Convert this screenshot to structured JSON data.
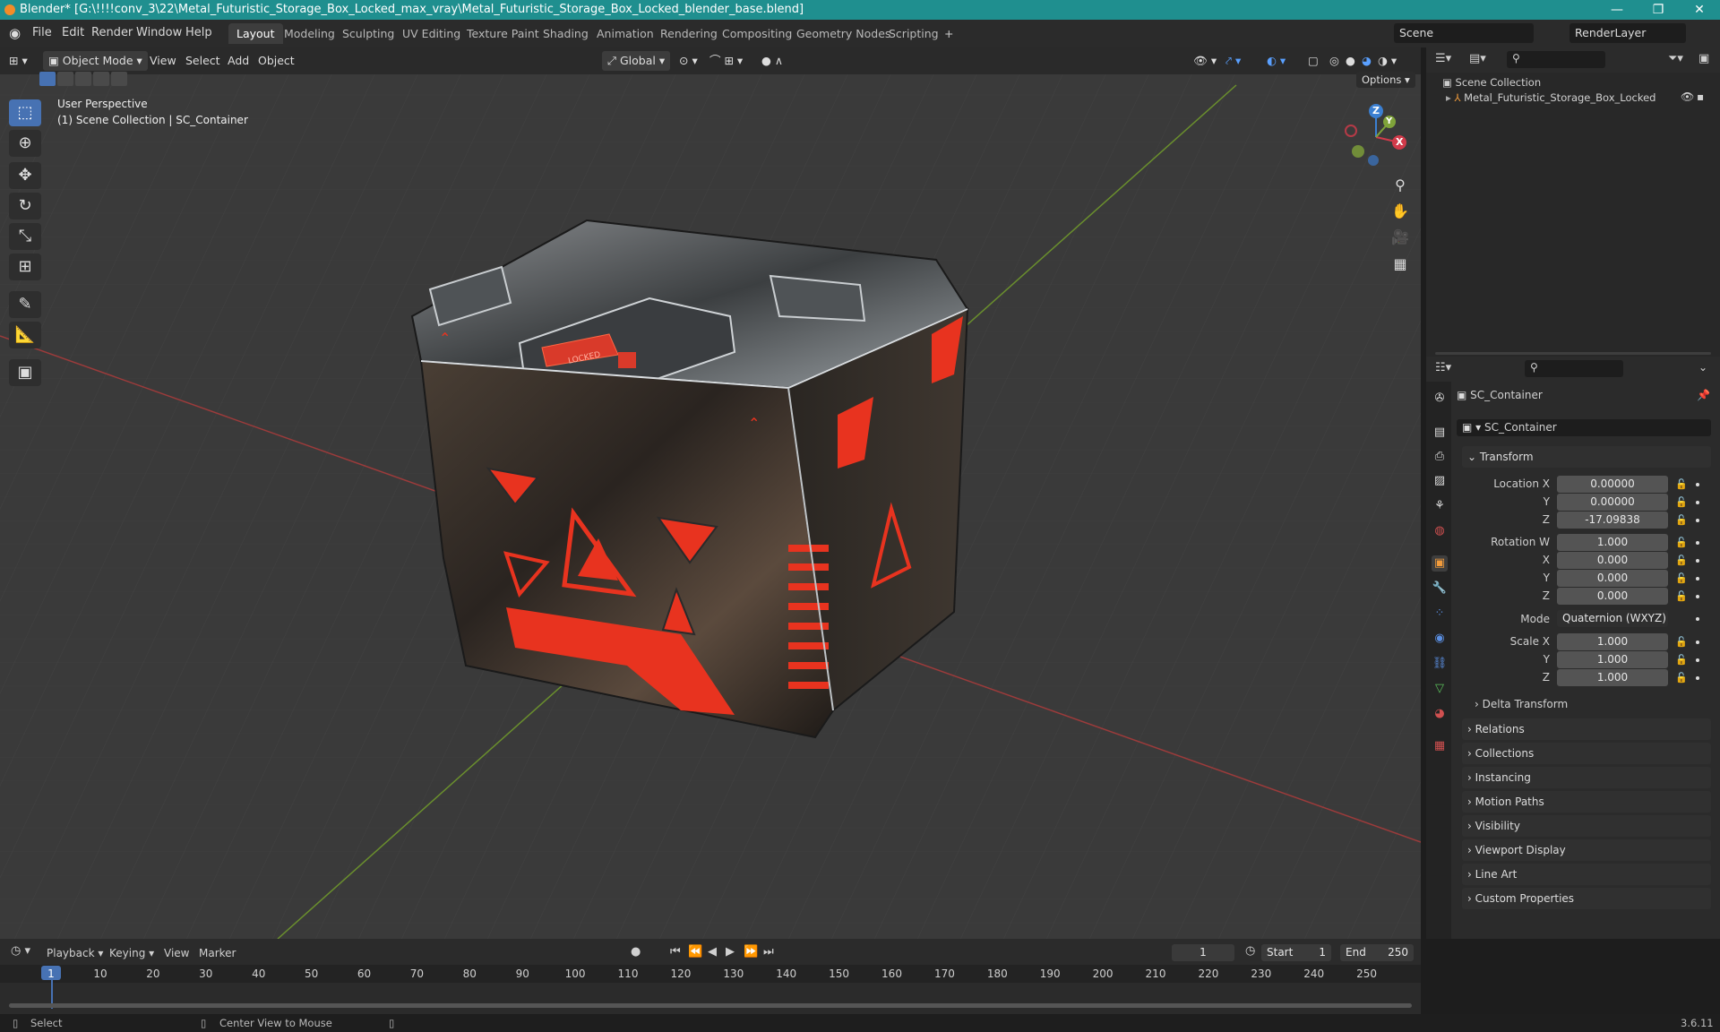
{
  "titlebar": {
    "title": "Blender* [G:\\!!!!conv_3\\22\\Metal_Futuristic_Storage_Box_Locked_max_vray\\Metal_Futuristic_Storage_Box_Locked_blender_base.blend]",
    "minimize": "—",
    "maximize": "❐",
    "close": "✕"
  },
  "menubar": {
    "items": [
      "File",
      "Edit",
      "Render",
      "Window",
      "Help"
    ],
    "workspaces": [
      "Layout",
      "Modeling",
      "Sculpting",
      "UV Editing",
      "Texture Paint",
      "Shading",
      "Animation",
      "Rendering",
      "Compositing",
      "Geometry Nodes",
      "Scripting"
    ],
    "add_workspace": "+",
    "scene": "Scene",
    "render_layer": "RenderLayer"
  },
  "viewport_header": {
    "mode": "Object Mode",
    "menus": [
      "View",
      "Select",
      "Add",
      "Object"
    ],
    "transform_orientation": "Global",
    "options": "Options"
  },
  "viewport": {
    "perspective": "User Perspective",
    "collection_info": "(1) Scene Collection | SC_Container",
    "box_label": "LOCKED",
    "gizmo": {
      "x": "X",
      "y": "Y",
      "z": "Z"
    }
  },
  "outliner": {
    "root": "Scene Collection",
    "items": [
      {
        "label": "Metal_Futuristic_Storage_Box_Locked"
      }
    ]
  },
  "properties": {
    "object_name": "SC_Container",
    "data_name": "SC_Container",
    "transform_title": "Transform",
    "location": {
      "label_x": "Location X",
      "label_y": "Y",
      "label_z": "Z",
      "x": "0.00000",
      "y": "0.00000",
      "z": "-17.09838"
    },
    "rotation": {
      "label_w": "Rotation W",
      "label_x": "X",
      "label_y": "Y",
      "label_z": "Z",
      "w": "1.000",
      "x": "0.000",
      "y": "0.000",
      "z": "0.000"
    },
    "mode_label": "Mode",
    "mode_value": "Quaternion (WXYZ)",
    "scale": {
      "label_x": "Scale X",
      "label_y": "Y",
      "label_z": "Z",
      "x": "1.000",
      "y": "1.000",
      "z": "1.000"
    },
    "delta_transform": "Delta Transform",
    "panels": [
      "Relations",
      "Collections",
      "Instancing",
      "Motion Paths",
      "Visibility",
      "Viewport Display",
      "Line Art",
      "Custom Properties"
    ]
  },
  "timeline": {
    "menus": [
      "Playback",
      "Keying",
      "View",
      "Marker"
    ],
    "current_frame": "1",
    "start_label": "Start",
    "start": "1",
    "end_label": "End",
    "end": "250",
    "ruler": [
      "1",
      "10",
      "20",
      "30",
      "40",
      "50",
      "60",
      "70",
      "80",
      "90",
      "100",
      "110",
      "120",
      "130",
      "140",
      "150",
      "160",
      "170",
      "180",
      "190",
      "200",
      "210",
      "220",
      "230",
      "240",
      "250"
    ]
  },
  "statusbar": {
    "select": "Select",
    "center_view": "Center View to Mouse",
    "version": "3.6.11"
  }
}
